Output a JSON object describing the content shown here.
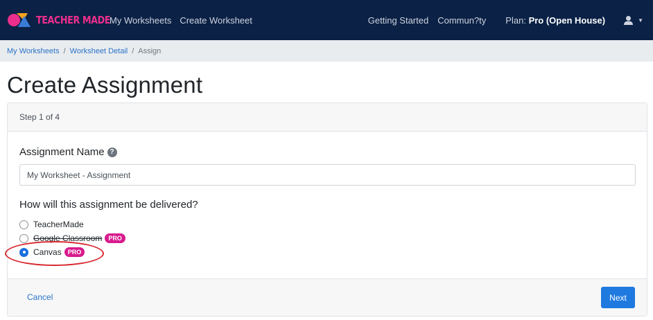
{
  "nav": {
    "brand": "TEACHER MADE",
    "links_left": [
      "My Worksheets",
      "Create Worksheet"
    ],
    "links_right": [
      "Getting Started",
      "Commun?ty"
    ],
    "plan_label": "Plan:",
    "plan_value": "Pro (Open House)",
    "user_icon": "user-icon"
  },
  "breadcrumb": {
    "items": [
      "My Worksheets",
      "Worksheet Detail"
    ],
    "separator": "/",
    "current": "Assign"
  },
  "page": {
    "title": "Create Assignment",
    "step": "Step 1 of 4"
  },
  "form": {
    "name_label": "Assignment Name",
    "name_value": "My Worksheet - Assignment",
    "help_glyph": "?",
    "delivery_question": "How will this assignment be delivered?",
    "options": [
      {
        "label": "TeacherMade",
        "selected": false,
        "pro": false
      },
      {
        "label": "Google Classroom",
        "selected": false,
        "pro": true
      },
      {
        "label": "Canvas",
        "selected": true,
        "pro": true
      }
    ],
    "pro_badge": "PRO"
  },
  "footer": {
    "cancel_label": "Cancel",
    "next_label": "Next"
  },
  "colors": {
    "navbar": "#0b2146",
    "brand": "#ec2e8c",
    "primary": "#1f7ae0",
    "pro_badge": "#d81b8c",
    "highlight": "#d7282f"
  }
}
